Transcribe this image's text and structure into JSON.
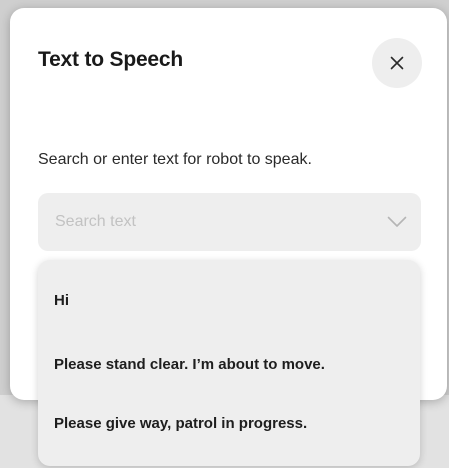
{
  "dialog": {
    "title": "Text to Speech",
    "close_label": "×",
    "instruction": "Search or enter text for robot to speak."
  },
  "search": {
    "placeholder": "Search text",
    "value": ""
  },
  "dropdown": {
    "items": [
      {
        "label": "Hi"
      },
      {
        "label": "Please stand clear. I’m about to move."
      },
      {
        "label": "Please give way, patrol in progress."
      }
    ]
  },
  "icons": {
    "close": "close-icon",
    "chevron": "chevron-down-icon"
  },
  "colors": {
    "dialog_background": "#ffffff",
    "field_background": "#eeeeee",
    "backdrop": "#cfcfcf",
    "text_primary": "#1a1a1a",
    "placeholder": "#c2c2c2"
  }
}
